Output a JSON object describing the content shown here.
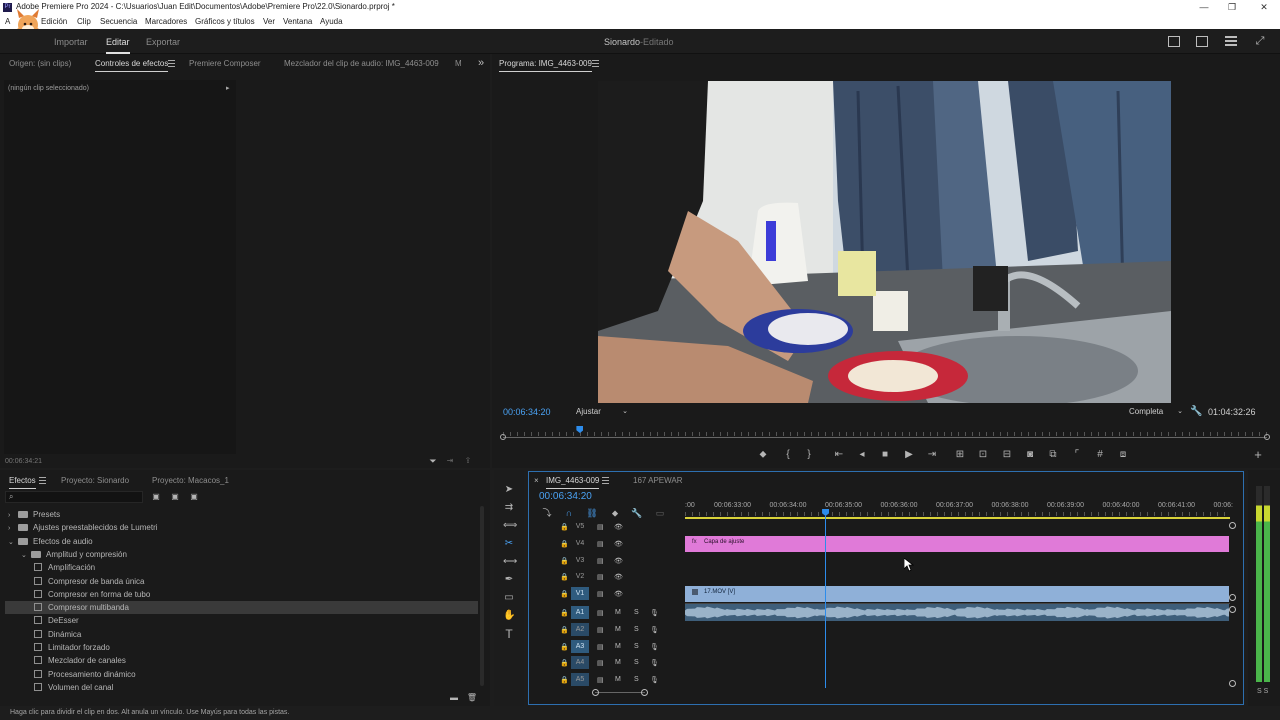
{
  "window": {
    "title": "Adobe Premiere Pro 2024 - C:\\Usuarios\\Juan Edit\\Documentos\\Adobe\\Premiere Pro\\22.0\\Sionardo.prproj *",
    "app_badge": "Pr",
    "minimize": "—",
    "maximize": "❐",
    "close": "✕"
  },
  "menu": [
    "A",
    "Edición",
    "Clip",
    "Secuencia",
    "Marcadores",
    "Gráficos y títulos",
    "Ver",
    "Ventana",
    "Ayuda"
  ],
  "workspace": {
    "tabs": [
      "Importar",
      "Editar",
      "Exportar"
    ],
    "active": "Editar",
    "project_name": "Sionardo",
    "separator": " - ",
    "project_state": "Editado"
  },
  "source_panel": {
    "tabs": [
      "Origen: (sin clips)",
      "Controles de efectos",
      "Premiere Composer",
      "Mezclador del clip de audio: IMG_4463-009",
      "M"
    ],
    "overflow": "»",
    "no_clip": "(ningún clip seleccionado)",
    "timecode": "00:06:34:21"
  },
  "program_monitor": {
    "title": "Programa: IMG_4463-009",
    "timecode": "00:06:34:20",
    "fit": "Ajustar",
    "quality": "Completa",
    "duration": "01:04:32:26",
    "playhead_fraction": 0.1
  },
  "effects_panel": {
    "tabs": [
      "Efectos",
      "Proyecto: Sionardo",
      "Proyecto: Macacos_1"
    ],
    "tree": [
      {
        "label": "Presets",
        "level": 0,
        "kind": "folder",
        "open": false
      },
      {
        "label": "Ajustes preestablecidos de Lumetri",
        "level": 0,
        "kind": "folder",
        "open": false
      },
      {
        "label": "Efectos de audio",
        "level": 0,
        "kind": "folder",
        "open": true
      },
      {
        "label": "Amplitud y compresión",
        "level": 1,
        "kind": "folder",
        "open": true
      },
      {
        "label": "Amplificación",
        "level": 2,
        "kind": "fx"
      },
      {
        "label": "Compresor de banda única",
        "level": 2,
        "kind": "fx"
      },
      {
        "label": "Compresor en forma de tubo",
        "level": 2,
        "kind": "fx"
      },
      {
        "label": "Compresor multibanda",
        "level": 2,
        "kind": "fx",
        "selected": true
      },
      {
        "label": "DeEsser",
        "level": 2,
        "kind": "fx"
      },
      {
        "label": "Dinámica",
        "level": 2,
        "kind": "fx"
      },
      {
        "label": "Limitador forzado",
        "level": 2,
        "kind": "fx"
      },
      {
        "label": "Mezclador de canales",
        "level": 2,
        "kind": "fx"
      },
      {
        "label": "Procesamiento dinámico",
        "level": 2,
        "kind": "fx"
      },
      {
        "label": "Volumen del canal",
        "level": 2,
        "kind": "fx"
      }
    ]
  },
  "timeline": {
    "tabs": [
      "IMG_4463-009",
      "167 APEWAR"
    ],
    "close": "×",
    "timecode": "00:06:34:20",
    "ruler": [
      ":00",
      "00:06:33:00",
      "00:06:34:00",
      "00:06:35:00",
      "00:06:36:00",
      "00:06:37:00",
      "00:06:38:00",
      "00:06:39:00",
      "00:06:40:00",
      "00:06:41:00",
      "00:06:"
    ],
    "video_tracks": [
      "V5",
      "V4",
      "V3",
      "V2",
      "V1"
    ],
    "audio_tracks": [
      "A1",
      "A2",
      "A3",
      "A4",
      "A5"
    ],
    "track_toggles": {
      "mute": "M",
      "solo": "S"
    },
    "clips": {
      "adjustment": "Capa de ajuste",
      "video": "17.MOV [V]"
    },
    "playhead_fraction": 0.257
  },
  "meter": {
    "labels": "S S"
  },
  "status_bar": "Haga clic para dividir el clip en dos. Alt anula un vínculo. Use Mayús para todas las pistas.",
  "colors": {
    "accent_blue": "#2d8ceb",
    "adjustment_clip": "#e07ad8",
    "video_clip": "#8fb0d8",
    "audio_clip": "#3e5e7a"
  }
}
